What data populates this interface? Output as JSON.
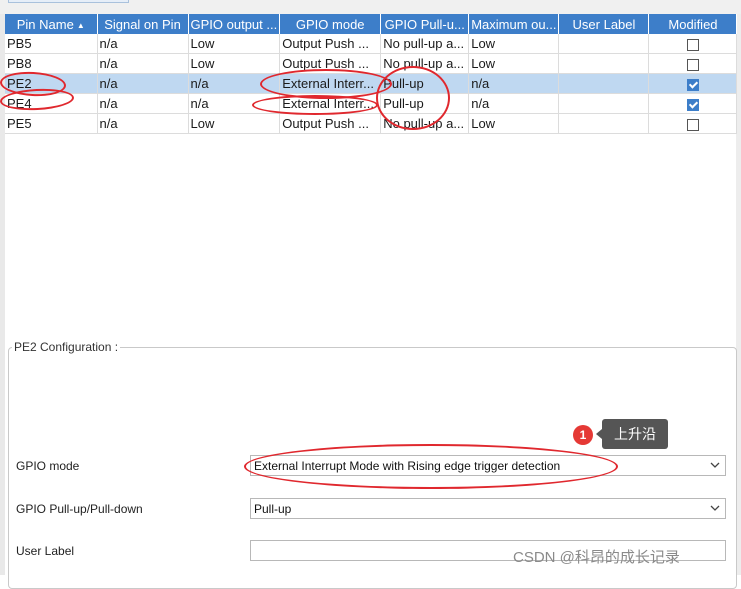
{
  "table": {
    "columns": [
      {
        "label": "Pin Name",
        "sorted": true
      },
      {
        "label": "Signal on Pin"
      },
      {
        "label": "GPIO output ..."
      },
      {
        "label": "GPIO mode"
      },
      {
        "label": "GPIO Pull-u..."
      },
      {
        "label": "Maximum ou..."
      },
      {
        "label": "User Label"
      },
      {
        "label": "Modified"
      }
    ],
    "rows": [
      {
        "pin": "PB5",
        "signal": "n/a",
        "output": "Low",
        "mode": "Output Push ...",
        "pull": "No pull-up a...",
        "max": "Low",
        "user_label": "",
        "modified": false,
        "selected": false
      },
      {
        "pin": "PB8",
        "signal": "n/a",
        "output": "Low",
        "mode": "Output Push ...",
        "pull": "No pull-up a...",
        "max": "Low",
        "user_label": "",
        "modified": false,
        "selected": false
      },
      {
        "pin": "PE2",
        "signal": "n/a",
        "output": "n/a",
        "mode": "External Interr...",
        "pull": "Pull-up",
        "max": "n/a",
        "user_label": "",
        "modified": true,
        "selected": true
      },
      {
        "pin": "PE4",
        "signal": "n/a",
        "output": "n/a",
        "mode": "External Interr...",
        "pull": "Pull-up",
        "max": "n/a",
        "user_label": "",
        "modified": true,
        "selected": false
      },
      {
        "pin": "PE5",
        "signal": "n/a",
        "output": "Low",
        "mode": "Output Push ...",
        "pull": "No pull-up a...",
        "max": "Low",
        "user_label": "",
        "modified": false,
        "selected": false
      }
    ]
  },
  "config": {
    "title": "PE2 Configuration :",
    "gpio_mode_label": "GPIO mode",
    "gpio_mode_value": "External Interrupt Mode with Rising edge trigger detection",
    "pull_label": "GPIO Pull-up/Pull-down",
    "pull_value": "Pull-up",
    "user_label_label": "User Label",
    "user_label_value": ""
  },
  "annotation": {
    "badge": "1",
    "tooltip": "上升沿"
  },
  "watermark": "CSDN @科昂的成长记录",
  "colors": {
    "header_bg": "#3d7ec9",
    "selected_row": "#bfd8f1",
    "annotation_red": "#e0282e"
  }
}
